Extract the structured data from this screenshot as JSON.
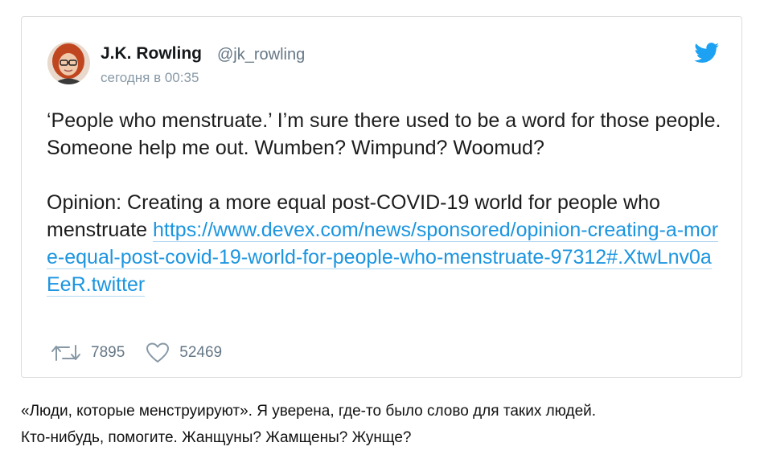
{
  "tweet": {
    "author_name": "J.K. Rowling",
    "author_handle": "@jk_rowling",
    "timestamp": "сегодня в 00:35",
    "text_paragraph_1": "‘People who menstruate.’ I’m sure there used to be a word for those people. Someone help me out. Wumben? Wimpund? Woomud?",
    "text_paragraph_2": "Opinion: Creating a more equal post-COVID-19 world for people who menstruate",
    "link_text": "https://www.devex.com/news/sponsored/opinion-creating-a-more-equal-post-covid-19-world-for-people-who-menstruate-97312#.XtwLnv0aEeR.twitter",
    "retweets": "7895",
    "likes": "52469"
  },
  "icons": {
    "brand": "twitter-bird-icon",
    "retweet": "retweet-icon",
    "like": "heart-icon"
  },
  "colors": {
    "link": "#1b95e0",
    "brand": "#1da1f2",
    "muted": "#657786"
  },
  "caption": {
    "line_1": "«Люди, которые менструируют». Я уверена, где-то было слово для таких людей.",
    "line_2": "Кто-нибудь, помогите. Жанщуны? Жамщены? Жунще?"
  }
}
